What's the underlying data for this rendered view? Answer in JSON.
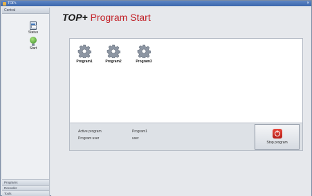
{
  "window": {
    "title": "TOP+"
  },
  "sidebar": {
    "header": "Central",
    "buttons": [
      {
        "label": "Status",
        "icon": "status-icon"
      },
      {
        "label": "Start",
        "icon": "start-icon"
      }
    ],
    "footer_tabs": [
      "Programs",
      "Recorder",
      "Tools"
    ]
  },
  "main": {
    "brand": "TOP+",
    "title": " Program Start",
    "programs": [
      {
        "label": "Program1",
        "icon": "gear-icon"
      },
      {
        "label": "Program2",
        "icon": "gear-icon"
      },
      {
        "label": "Program3",
        "icon": "gear-icon"
      }
    ],
    "info": {
      "active_label": "Active program",
      "active_value": "Program1",
      "user_label": "Program user",
      "user_value": "user"
    },
    "stop_button": {
      "label": "Stop program",
      "icon": "stop-icon"
    }
  },
  "colors": {
    "accent_red": "#c41e25",
    "titlebar_blue": "#3b67ad"
  }
}
